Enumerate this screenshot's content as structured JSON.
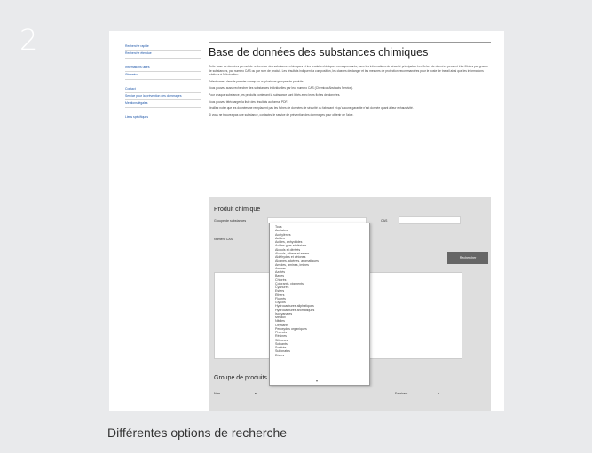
{
  "step": {
    "number": "2"
  },
  "caption": "Différentes options de recherche",
  "sidebar": {
    "group1": [
      "Recherche rapide",
      "Recherche étendue"
    ],
    "group2": [
      "Informations utiles",
      "Glossaire"
    ],
    "group3": [
      "Contact",
      "Service pour la prévention des dommages",
      "Mentions légales"
    ],
    "group4": [
      "Liens spécifiques"
    ]
  },
  "main": {
    "title": "Base de données des substances chimiques",
    "paragraphs": [
      "Cette base de données permet de rechercher des substances chimiques et les produits chimiques correspondants, avec les informations de sécurité principales. Les fiches de données peuvent être filtrées par groupe de substances, par numéro CAS ou par nom de produit. Les résultats indiquent la composition, les classes de danger et les mesures de protection recommandées pour le poste de travail ainsi que les informations relatives à l'élimination.",
      "Sélectionnez dans le premier champ un ou plusieurs groupes de produits.",
      "Vous pouvez aussi rechercher des substances individuelles par leur numéro CAS (Chemical Abstracts Service).",
      "Pour chaque substance, les produits contenant la substance sont listés avec leurs fiches de données.",
      "Vous pouvez télécharger la liste des résultats au format PDF.",
      "Veuillez noter que les données ne remplacent pas les fiches de données de sécurité du fabricant et qu'aucune garantie n'est donnée quant à leur exhaustivité.",
      "Si vous ne trouvez pas une substance, contactez le service de prévention des dommages pour obtenir de l'aide."
    ]
  },
  "form": {
    "title": "Produit chimique",
    "group_label": "Groupe de substances",
    "right_label": "CAS",
    "cas_label": "Numéro CAS",
    "search_button": "Rechercher",
    "section2_title": "Groupe de produits",
    "row_label_left": "Nom",
    "row_label_right": "Fabricant"
  },
  "dropdown": {
    "options": [
      "Tous",
      "Acétates",
      "Acétylènes",
      "Acides",
      "Acides, anhydrides",
      "Acides gras et dérivés",
      "Alcools et dérivés",
      "Alcools, éthers et esters",
      "Aldéhydes et cétones",
      "Alcanes, alcènes, aromatiques",
      "Amides, amines, imines",
      "Amines",
      "Azotés",
      "Bases",
      "Chlorés",
      "Colorants, pigments",
      "Cyanures",
      "Esters",
      "Éthers",
      "Fluorés",
      "Glycols",
      "Hydrocarbures aliphatiques",
      "Hydrocarbures aromatiques",
      "Isocyanates",
      "Métaux",
      "Nitriles",
      "Oxydants",
      "Peroxydes organiques",
      "Phénols",
      "Résines",
      "Silicones",
      "Solvants",
      "Soufrés",
      "Sulfonates",
      "Divers"
    ]
  }
}
